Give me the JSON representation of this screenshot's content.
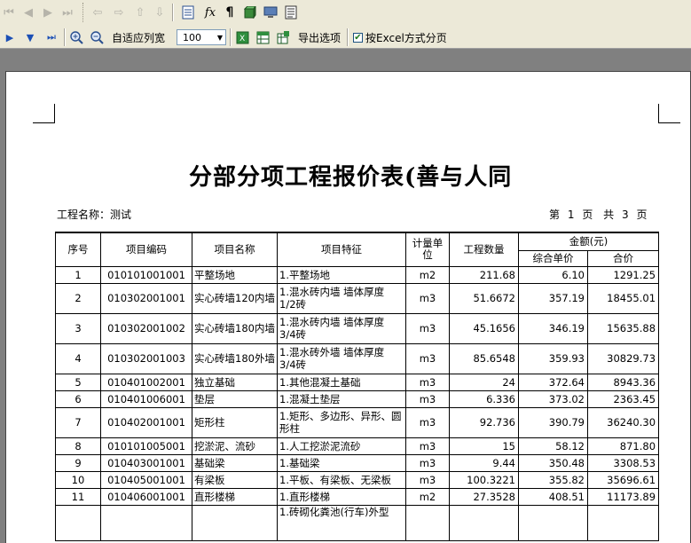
{
  "toolbar1": {
    "buttons": [
      "first-page-icon",
      "prev-page-icon",
      "next-page-icon",
      "last-page-icon",
      "back-icon",
      "forward-icon",
      "move-up-icon",
      "move-down-icon",
      "page-setup-icon",
      "formula-icon",
      "paragraph-icon",
      "cube-icon",
      "screen-icon",
      "report-icon"
    ],
    "glyphs": {
      "formula": "𝑓x",
      "paragraph": "¶"
    }
  },
  "toolbar2": {
    "fit_width_label": "自适应列宽",
    "zoom_value": "100",
    "export_label": "导出选项",
    "excel_paging_label": "按Excel方式分页",
    "excel_paging_checked": true
  },
  "report": {
    "title": "分部分项工程报价表(善与人同",
    "project_label": "工程名称：",
    "project_name": "测试",
    "page_word_1": "第",
    "page_current": "1",
    "page_word_2": "页",
    "page_word_3": "共",
    "page_total": "3",
    "page_word_4": "页",
    "headers": {
      "index": "序号",
      "code": "项目编码",
      "name": "项目名称",
      "feature": "项目特征",
      "unit": "计量单位",
      "quantity": "工程数量",
      "amount": "金额(元)",
      "unit_price": "综合单价",
      "total": "合价"
    },
    "rows": [
      {
        "index": "1",
        "code": "010101001001",
        "name": "平整场地",
        "feature": "1.平整场地",
        "unit": "m2",
        "quantity": "211.68",
        "unit_price": "6.10",
        "total": "1291.25"
      },
      {
        "index": "2",
        "code": "010302001001",
        "name": "实心砖墙120内墙",
        "feature": "1.混水砖内墙 墙体厚度 1/2砖",
        "unit": "m3",
        "quantity": "51.6672",
        "unit_price": "357.19",
        "total": "18455.01"
      },
      {
        "index": "3",
        "code": "010302001002",
        "name": "实心砖墙180内墙",
        "feature": "1.混水砖内墙 墙体厚度 3/4砖",
        "unit": "m3",
        "quantity": "45.1656",
        "unit_price": "346.19",
        "total": "15635.88"
      },
      {
        "index": "4",
        "code": "010302001003",
        "name": "实心砖墙180外墙",
        "feature": "1.混水砖外墙 墙体厚度 3/4砖",
        "unit": "m3",
        "quantity": "85.6548",
        "unit_price": "359.93",
        "total": "30829.73"
      },
      {
        "index": "5",
        "code": "010401002001",
        "name": "独立基础",
        "feature": "1.其他混凝土基础",
        "unit": "m3",
        "quantity": "24",
        "unit_price": "372.64",
        "total": "8943.36"
      },
      {
        "index": "6",
        "code": "010401006001",
        "name": "垫层",
        "feature": "1.混凝土垫层",
        "unit": "m3",
        "quantity": "6.336",
        "unit_price": "373.02",
        "total": "2363.45"
      },
      {
        "index": "7",
        "code": "010402001001",
        "name": "矩形柱",
        "feature": "1.矩形、多边形、异形、圆形柱",
        "unit": "m3",
        "quantity": "92.736",
        "unit_price": "390.79",
        "total": "36240.30"
      },
      {
        "index": "8",
        "code": "010101005001",
        "name": "挖淤泥、流砂",
        "feature": "1.人工挖淤泥流砂",
        "unit": "m3",
        "quantity": "15",
        "unit_price": "58.12",
        "total": "871.80"
      },
      {
        "index": "9",
        "code": "010403001001",
        "name": "基础梁",
        "feature": "1.基础梁",
        "unit": "m3",
        "quantity": "9.44",
        "unit_price": "350.48",
        "total": "3308.53"
      },
      {
        "index": "10",
        "code": "010405001001",
        "name": "有梁板",
        "feature": "1.平板、有梁板、无梁板",
        "unit": "m3",
        "quantity": "100.3221",
        "unit_price": "355.82",
        "total": "35696.61"
      },
      {
        "index": "11",
        "code": "010406001001",
        "name": "直形楼梯",
        "feature": "1.直形楼梯",
        "unit": "m2",
        "quantity": "27.3528",
        "unit_price": "408.51",
        "total": "11173.89"
      },
      {
        "index": "",
        "code": "",
        "name": "",
        "feature": "1.砖砌化粪池(行车)外型",
        "unit": "",
        "quantity": "",
        "unit_price": "",
        "total": ""
      }
    ]
  }
}
